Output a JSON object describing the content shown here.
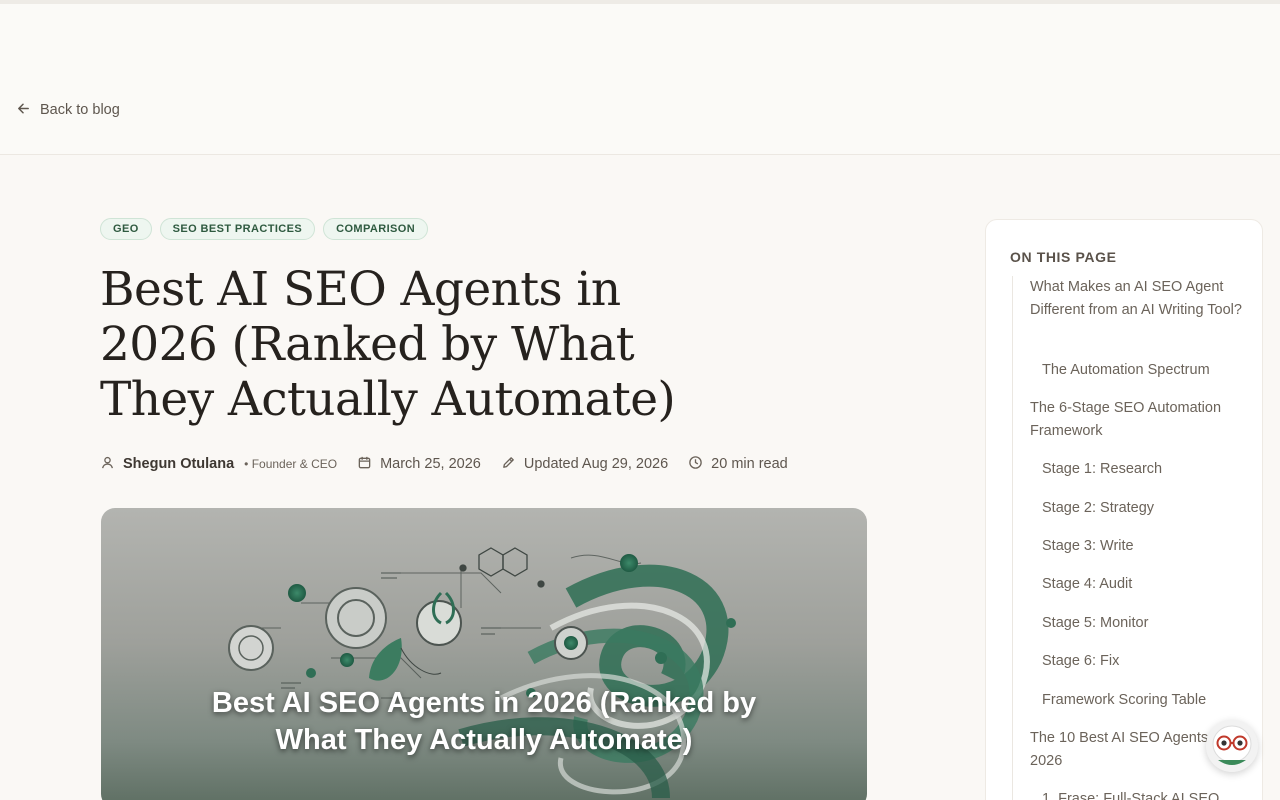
{
  "nav": {
    "back_label": "Back to blog"
  },
  "tags": [
    "GEO",
    "SEO BEST PRACTICES",
    "COMPARISON"
  ],
  "article": {
    "title": "Best AI SEO Agents in 2026 (Ranked by What They Actually Automate)",
    "author": "Shegun Otulana",
    "author_role": "• Founder & CEO",
    "published": "March 25, 2026",
    "updated": "Updated Aug 29, 2026",
    "read_time": "20 min read",
    "hero_title": "Best AI SEO Agents in 2026 (Ranked by What They Actually Automate)"
  },
  "toc": {
    "heading": "ON THIS PAGE",
    "items": [
      {
        "label": "What Makes an AI SEO Agent Different from an AI Writing Tool?",
        "level": 1
      },
      {
        "label": "The Automation Spectrum",
        "level": 2
      },
      {
        "label": "The 6-Stage SEO Automation Framework",
        "level": 1
      },
      {
        "label": "Stage 1: Research",
        "level": 2
      },
      {
        "label": "Stage 2: Strategy",
        "level": 2
      },
      {
        "label": "Stage 3: Write",
        "level": 2
      },
      {
        "label": "Stage 4: Audit",
        "level": 2
      },
      {
        "label": "Stage 5: Monitor",
        "level": 2
      },
      {
        "label": "Stage 6: Fix",
        "level": 2
      },
      {
        "label": "Framework Scoring Table",
        "level": 2
      },
      {
        "label": "The 10 Best AI SEO Agents 2026",
        "level": 1
      },
      {
        "label": "1. Frase: Full-Stack AI SEO",
        "level": 2
      }
    ]
  },
  "colors": {
    "tag_bg": "#eef6f0",
    "tag_text": "#2f5a40",
    "accent_green": "#2f8a63"
  },
  "icons": {
    "back": "arrow-left-icon",
    "author": "user-icon",
    "date": "calendar-icon",
    "updated": "pencil-icon",
    "time": "clock-icon"
  }
}
